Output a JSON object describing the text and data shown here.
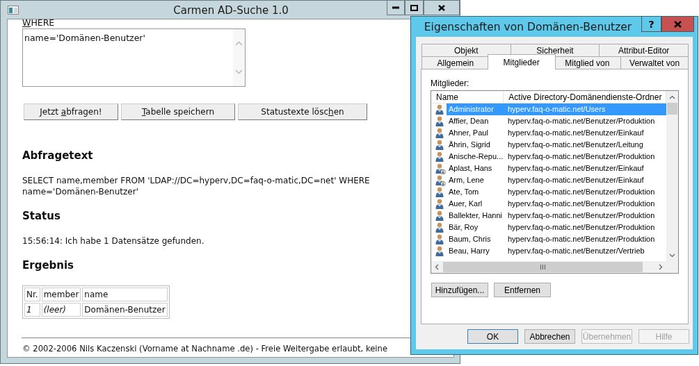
{
  "main_window": {
    "title": "Carmen AD-Suche 1.0",
    "where_label": {
      "access_key": "W",
      "text_after": "HERE"
    },
    "where_value": "name='Domänen-Benutzer'",
    "buttons": [
      {
        "text_before": "Jetzt ",
        "access_key": "a",
        "text_after": "bfragen!"
      },
      {
        "access_key": "T",
        "text_after": "abelle speichern"
      },
      {
        "text_before": "Statustexte lösc",
        "access_key": "h",
        "text_after": "en"
      }
    ],
    "sections": [
      {
        "heading": "Abfragetext",
        "text": "SELECT name,member FROM 'LDAP://DC=hyperv,DC=faq-o-matic,DC=net' WHERE name='Domänen-Benutzer'"
      },
      {
        "heading": "Status",
        "text": "15:56:14: Ich habe 1 Datensätze gefunden."
      }
    ],
    "result_heading": "Ergebnis",
    "result_table": {
      "columns": [
        "Nr.",
        "member",
        "name"
      ],
      "rows": [
        [
          {
            "text": "1",
            "italic": true
          },
          {
            "text": "(leer)",
            "italic": true
          },
          {
            "text": "Domänen-Benutzer",
            "italic": false
          }
        ]
      ]
    },
    "footer": "© 2002-2006 Nils Kaczenski (Vorname at Nachname .de) - Freie Weitergabe erlaubt, keine"
  },
  "dialog": {
    "title": "Eigenschaften von Domänen-Benutzer",
    "help_button": "?",
    "tabs_row_1": [
      {
        "label": "Objekt",
        "selected": false
      },
      {
        "label": "Sicherheit",
        "selected": false
      },
      {
        "label": "Attribut-Editor",
        "selected": false
      }
    ],
    "tabs_row_2": [
      {
        "label": "Allgemein",
        "selected": false
      },
      {
        "label": "Mitglieder",
        "selected": true
      },
      {
        "label": "Mitglied von",
        "selected": false
      },
      {
        "label": "Verwaltet von",
        "selected": false
      }
    ],
    "list_label": "Mitglieder:",
    "list": {
      "columns": [
        "Name",
        "Active Directory-Domänendienste-Ordner"
      ],
      "rows": [
        {
          "name": "Administrator",
          "folder": "hyperv.faq-o-matic.net/Users",
          "kind": "user",
          "selected": true
        },
        {
          "name": "Affier, Dean",
          "folder": "hyperv.faq-o-matic.net/Benutzer/Produktion",
          "kind": "user",
          "selected": false
        },
        {
          "name": "Ahner, Paul",
          "folder": "hyperv.faq-o-matic.net/Benutzer/Einkauf",
          "kind": "user",
          "selected": false
        },
        {
          "name": "Ährin, Sigrid",
          "folder": "hyperv.faq-o-matic.net/Benutzer/Leitung",
          "kind": "user",
          "selected": false
        },
        {
          "name": "Anische-Repu...",
          "folder": "hyperv.faq-o-matic.net/Benutzer/Produktion",
          "kind": "user",
          "selected": false
        },
        {
          "name": "Aplast, Hans",
          "folder": "hyperv.faq-o-matic.net/Benutzer/Einkauf",
          "kind": "disabled-user",
          "selected": false
        },
        {
          "name": "Arm, Lene",
          "folder": "hyperv.faq-o-matic.net/Benutzer/Einkauf",
          "kind": "disabled-user",
          "selected": false
        },
        {
          "name": "Ate, Tom",
          "folder": "hyperv.faq-o-matic.net/Benutzer/Produktion",
          "kind": "user",
          "selected": false
        },
        {
          "name": "Auer, Karl",
          "folder": "hyperv.faq-o-matic.net/Benutzer/Produktion",
          "kind": "user",
          "selected": false
        },
        {
          "name": "Ballekter, Hanni",
          "folder": "hyperv.faq-o-matic.net/Benutzer/Produktion",
          "kind": "user",
          "selected": false
        },
        {
          "name": "Bär, Roy",
          "folder": "hyperv.faq-o-matic.net/Benutzer/Produktion",
          "kind": "user",
          "selected": false
        },
        {
          "name": "Baum, Chris",
          "folder": "hyperv.faq-o-matic.net/Benutzer/Produktion",
          "kind": "user",
          "selected": false
        },
        {
          "name": "Beau, Harry",
          "folder": "hyperv.faq-o-matic.net/Benutzer/Vertrieb",
          "kind": "user",
          "selected": false
        }
      ]
    },
    "list_buttons": [
      "Hinzufügen...",
      "Entfernen"
    ],
    "buttons": [
      {
        "label": "OK",
        "default": true,
        "disabled": false
      },
      {
        "label": "Abbrechen",
        "default": false,
        "disabled": false
      },
      {
        "label": "Übernehmen",
        "default": false,
        "disabled": true
      },
      {
        "label": "Hilfe",
        "default": false,
        "disabled": true
      }
    ]
  }
}
